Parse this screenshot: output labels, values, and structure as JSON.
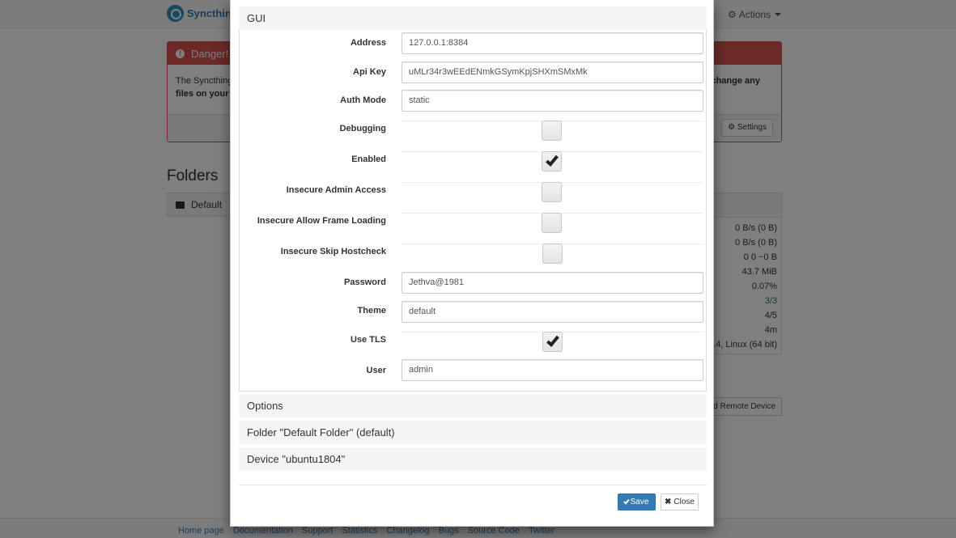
{
  "app": {
    "brand": "Syncthing",
    "actions_label": "Actions"
  },
  "background": {
    "danger": {
      "title": "Danger!",
      "body_left_1": "The Syncthing",
      "body_left_2": "files on your",
      "body_right": "change any",
      "settings_button": "Settings"
    },
    "folders_title": "Folders",
    "folder_name": "Default",
    "device_stats": [
      "0 B/s (0 B)",
      "0 B/s (0 B)",
      "0   0   ~0 B",
      "43.7 MiB",
      "0.07%",
      "3/3",
      "4/5",
      "4m",
      ".4, Linux (64 bit)"
    ],
    "add_remote_device": "dd Remote Device",
    "footer_links": [
      "Home page",
      "Documentation",
      "Support",
      "Statistics",
      "Changelog",
      "Bugs",
      "Source Code",
      "Twitter"
    ]
  },
  "modal": {
    "gui_section": {
      "title": "GUI",
      "fields": {
        "address": {
          "label": "Address",
          "value": "127.0.0.1:8384"
        },
        "api_key": {
          "label": "Api Key",
          "value": "uMLr34r3wEEdENmkGSymKpjSHXmSMxMk"
        },
        "auth_mode": {
          "label": "Auth Mode",
          "value": "static"
        },
        "debugging": {
          "label": "Debugging",
          "checked": false
        },
        "enabled": {
          "label": "Enabled",
          "checked": true
        },
        "insecure_admin_access": {
          "label": "Insecure Admin Access",
          "checked": false
        },
        "insecure_allow_frame_loading": {
          "label": "Insecure Allow Frame Loading",
          "checked": false
        },
        "insecure_skip_hostcheck": {
          "label": "Insecure Skip Hostcheck",
          "checked": false
        },
        "password": {
          "label": "Password",
          "value": "Jethva@1981"
        },
        "theme": {
          "label": "Theme",
          "value": "default"
        },
        "use_tls": {
          "label": "Use TLS",
          "checked": true
        },
        "user": {
          "label": "User",
          "value": "admin"
        }
      }
    },
    "sections": {
      "options": "Options",
      "folder": "Folder \"Default Folder\" (default)",
      "device": "Device \"ubuntu1804\""
    },
    "buttons": {
      "save": "Save",
      "close": "Close"
    }
  },
  "colors": {
    "danger": "#d9534f",
    "primary": "#337ab7",
    "overlay": "rgba(0,0,0,0.5)"
  }
}
